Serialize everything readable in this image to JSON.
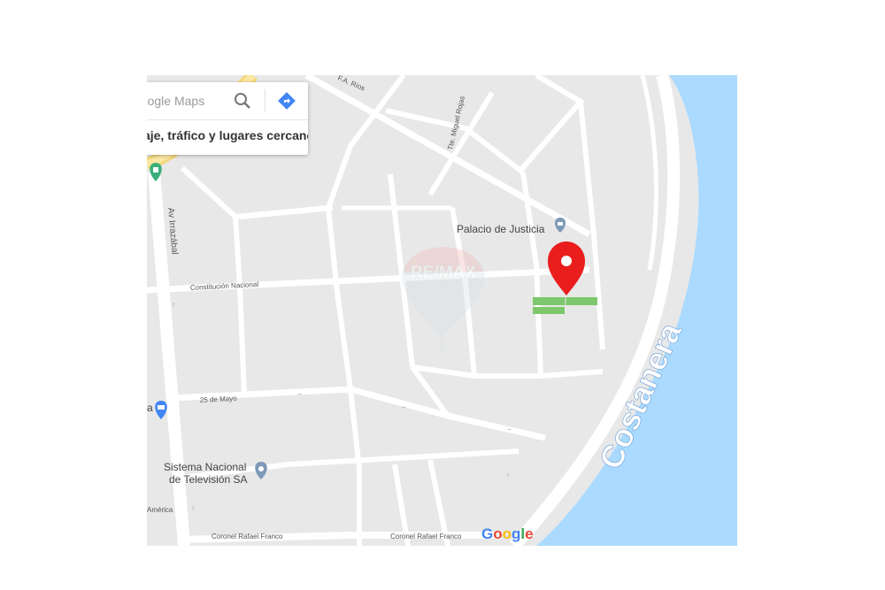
{
  "search": {
    "placeholder": "Buscar en Google Maps",
    "link_text": "Viaje, tráfico y lugares cercanos"
  },
  "streets": {
    "av_irrazabal": "Av Irrazábal",
    "constitucion": "Constitución Nacional",
    "veinticinco_mayo": "25 de Mayo",
    "coronel_franco_1": "Coronel Rafael Franco",
    "coronel_franco_2": "Coronel Rafael Franco",
    "miguel_rojas": "Tte. Miguel Rojas",
    "fa_rios": "F.A. Ríos",
    "america": "América"
  },
  "pois": {
    "palacio": "Palacio de Justicia",
    "sistema_line1": "Sistema Nacional",
    "sistema_line2": "de Televisión SA",
    "market_partial": "a"
  },
  "water_label": "Costanera",
  "watermark": "RE/MAX",
  "google_logo": {
    "letters": [
      "G",
      "o",
      "o",
      "g",
      "l",
      "e"
    ]
  },
  "colors": {
    "water": "#aadaff",
    "road": "#ffffff",
    "land": "#e8e8e8",
    "marker": "#ea1d1d",
    "lot": "#7dc86c",
    "poi_icon": "#7e99b8",
    "directions": "#4285f4",
    "shopping": "#4285f4"
  },
  "icons": {
    "search": "search-icon",
    "directions": "directions-icon",
    "marker": "map-pin-icon",
    "courthouse": "courthouse-icon",
    "tv": "place-icon",
    "shopping": "shopping-cart-icon",
    "park": "monument-icon"
  }
}
